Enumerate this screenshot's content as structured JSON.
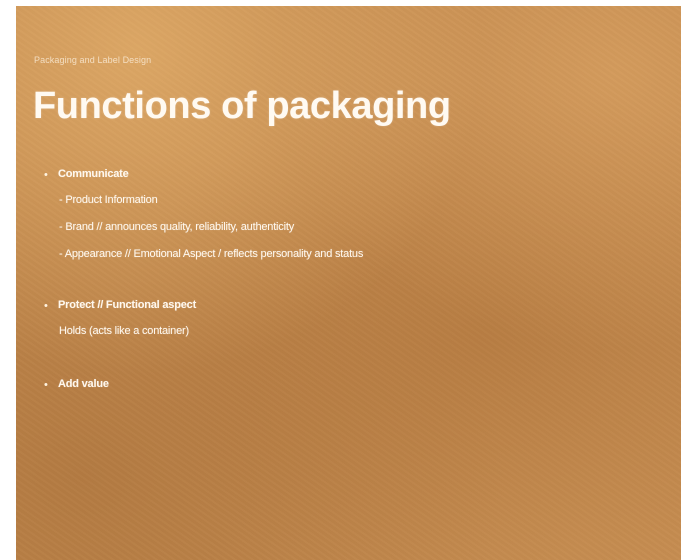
{
  "slide": {
    "subtitle": "Packaging and Label Design",
    "title": "Functions of packaging",
    "bullets": [
      {
        "marker": "•",
        "heading": "Communicate",
        "sub_items": [
          "- Product Information",
          "- Brand // announces quality, reliability, authenticity",
          "- Appearance // Emotional Aspect / reflects personality and status"
        ]
      },
      {
        "marker": "•",
        "heading": "Protect // Functional aspect",
        "sub_items": [
          "Holds (acts like a container)"
        ]
      },
      {
        "marker": "•",
        "heading": "Add value",
        "sub_items": []
      }
    ]
  }
}
